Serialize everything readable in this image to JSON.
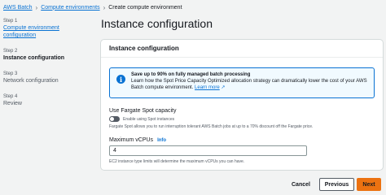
{
  "breadcrumb": {
    "items": [
      "AWS Batch",
      "Compute environments"
    ],
    "current": "Create compute environment",
    "separator": "›"
  },
  "steps": [
    {
      "num": "Step 1",
      "label": "Compute environment configuration",
      "state": "link"
    },
    {
      "num": "Step 2",
      "label": "Instance configuration",
      "state": "active"
    },
    {
      "num": "Step 3",
      "label": "Network configuration",
      "state": "disabled"
    },
    {
      "num": "Step 4",
      "label": "Review",
      "state": "disabled"
    }
  ],
  "page_title": "Instance configuration",
  "card": {
    "header": "Instance configuration",
    "alert": {
      "icon": "info-icon",
      "title": "Save up to 90% on fully managed batch processing",
      "body": "Learn how the Spot Price Capacity Optimized allocation strategy can dramatically lower the cost of your AWS Batch compute environment.",
      "link_text": "Learn more"
    },
    "fargate": {
      "label": "Use Fargate Spot capacity",
      "toggle_label": "Enable using Spot instances",
      "toggle_on": false,
      "description": "Fargate Spot allows you to run interruption tolerant AWS Batch jobs at up to a 70% discount off the Fargate price."
    },
    "vcpus": {
      "label": "Maximum vCPUs",
      "info": "Info",
      "value": "4",
      "description": "EC2 instance type limits will determine the maximum vCPUs you can have."
    }
  },
  "footer": {
    "cancel": "Cancel",
    "previous": "Previous",
    "next": "Next"
  },
  "colors": {
    "link": "#0972d3",
    "primary_button": "#ec7211",
    "alert_bg": "#f1faff"
  }
}
